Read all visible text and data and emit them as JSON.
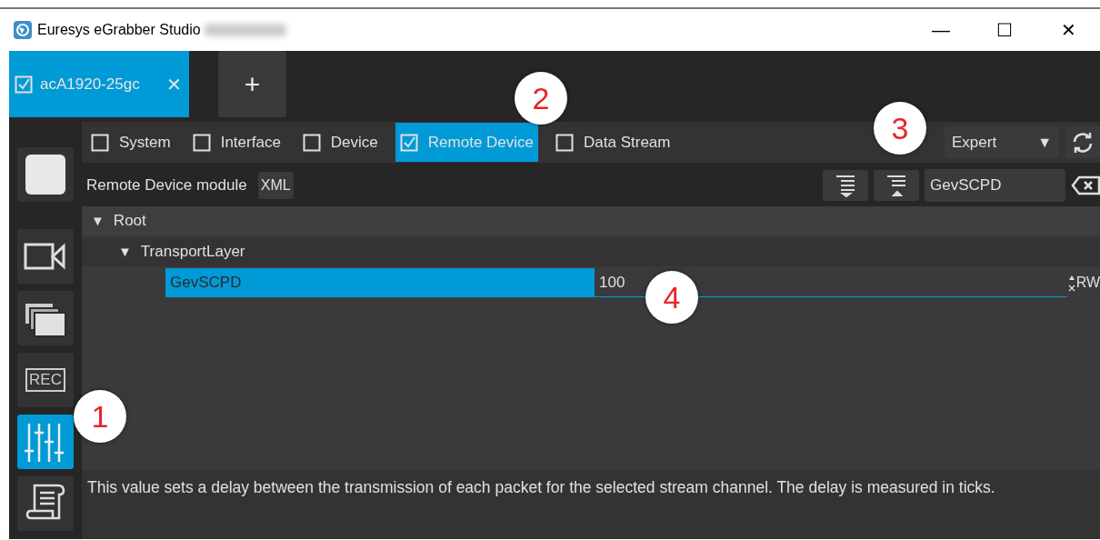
{
  "window": {
    "title": "Euresys eGrabber Studio",
    "controls": [
      "—",
      "☐",
      "✕"
    ]
  },
  "tabs": [
    {
      "label": "acA1920-25gc",
      "checked": true,
      "selected": true,
      "close": "✕"
    }
  ],
  "new_tab": "+",
  "sidebar": {
    "items": [
      {
        "selected": false
      },
      {
        "selected": false
      },
      {
        "selected": false
      },
      {
        "label": "REC",
        "selected": false
      },
      {
        "selected": true
      },
      {
        "selected": false
      }
    ]
  },
  "modules": [
    {
      "label": "System",
      "checked": false
    },
    {
      "label": "Interface",
      "checked": false
    },
    {
      "label": "Device",
      "checked": false
    },
    {
      "label": "Remote Device",
      "checked": true
    },
    {
      "label": "Data Stream",
      "checked": false
    }
  ],
  "visibility": {
    "value": "Expert",
    "caret": "▼"
  },
  "toolbar": {
    "module_label": "Remote Device module",
    "xml_button": "XML",
    "search": {
      "value": "GevSCPD"
    }
  },
  "tree": [
    {
      "label": "Root",
      "expanded": true,
      "arrow": "▼",
      "children": [
        {
          "label": "TransportLayer",
          "expanded": true,
          "arrow": "▼",
          "children": [
            {
              "label": "GevSCPD",
              "value": "100",
              "access": "RW",
              "selected": true
            }
          ]
        }
      ]
    }
  ],
  "description": "This value sets a delay between the transmission of each packet for the selected stream channel. The delay is measured in ticks.",
  "annotations": [
    "1",
    "2",
    "3",
    "4"
  ]
}
